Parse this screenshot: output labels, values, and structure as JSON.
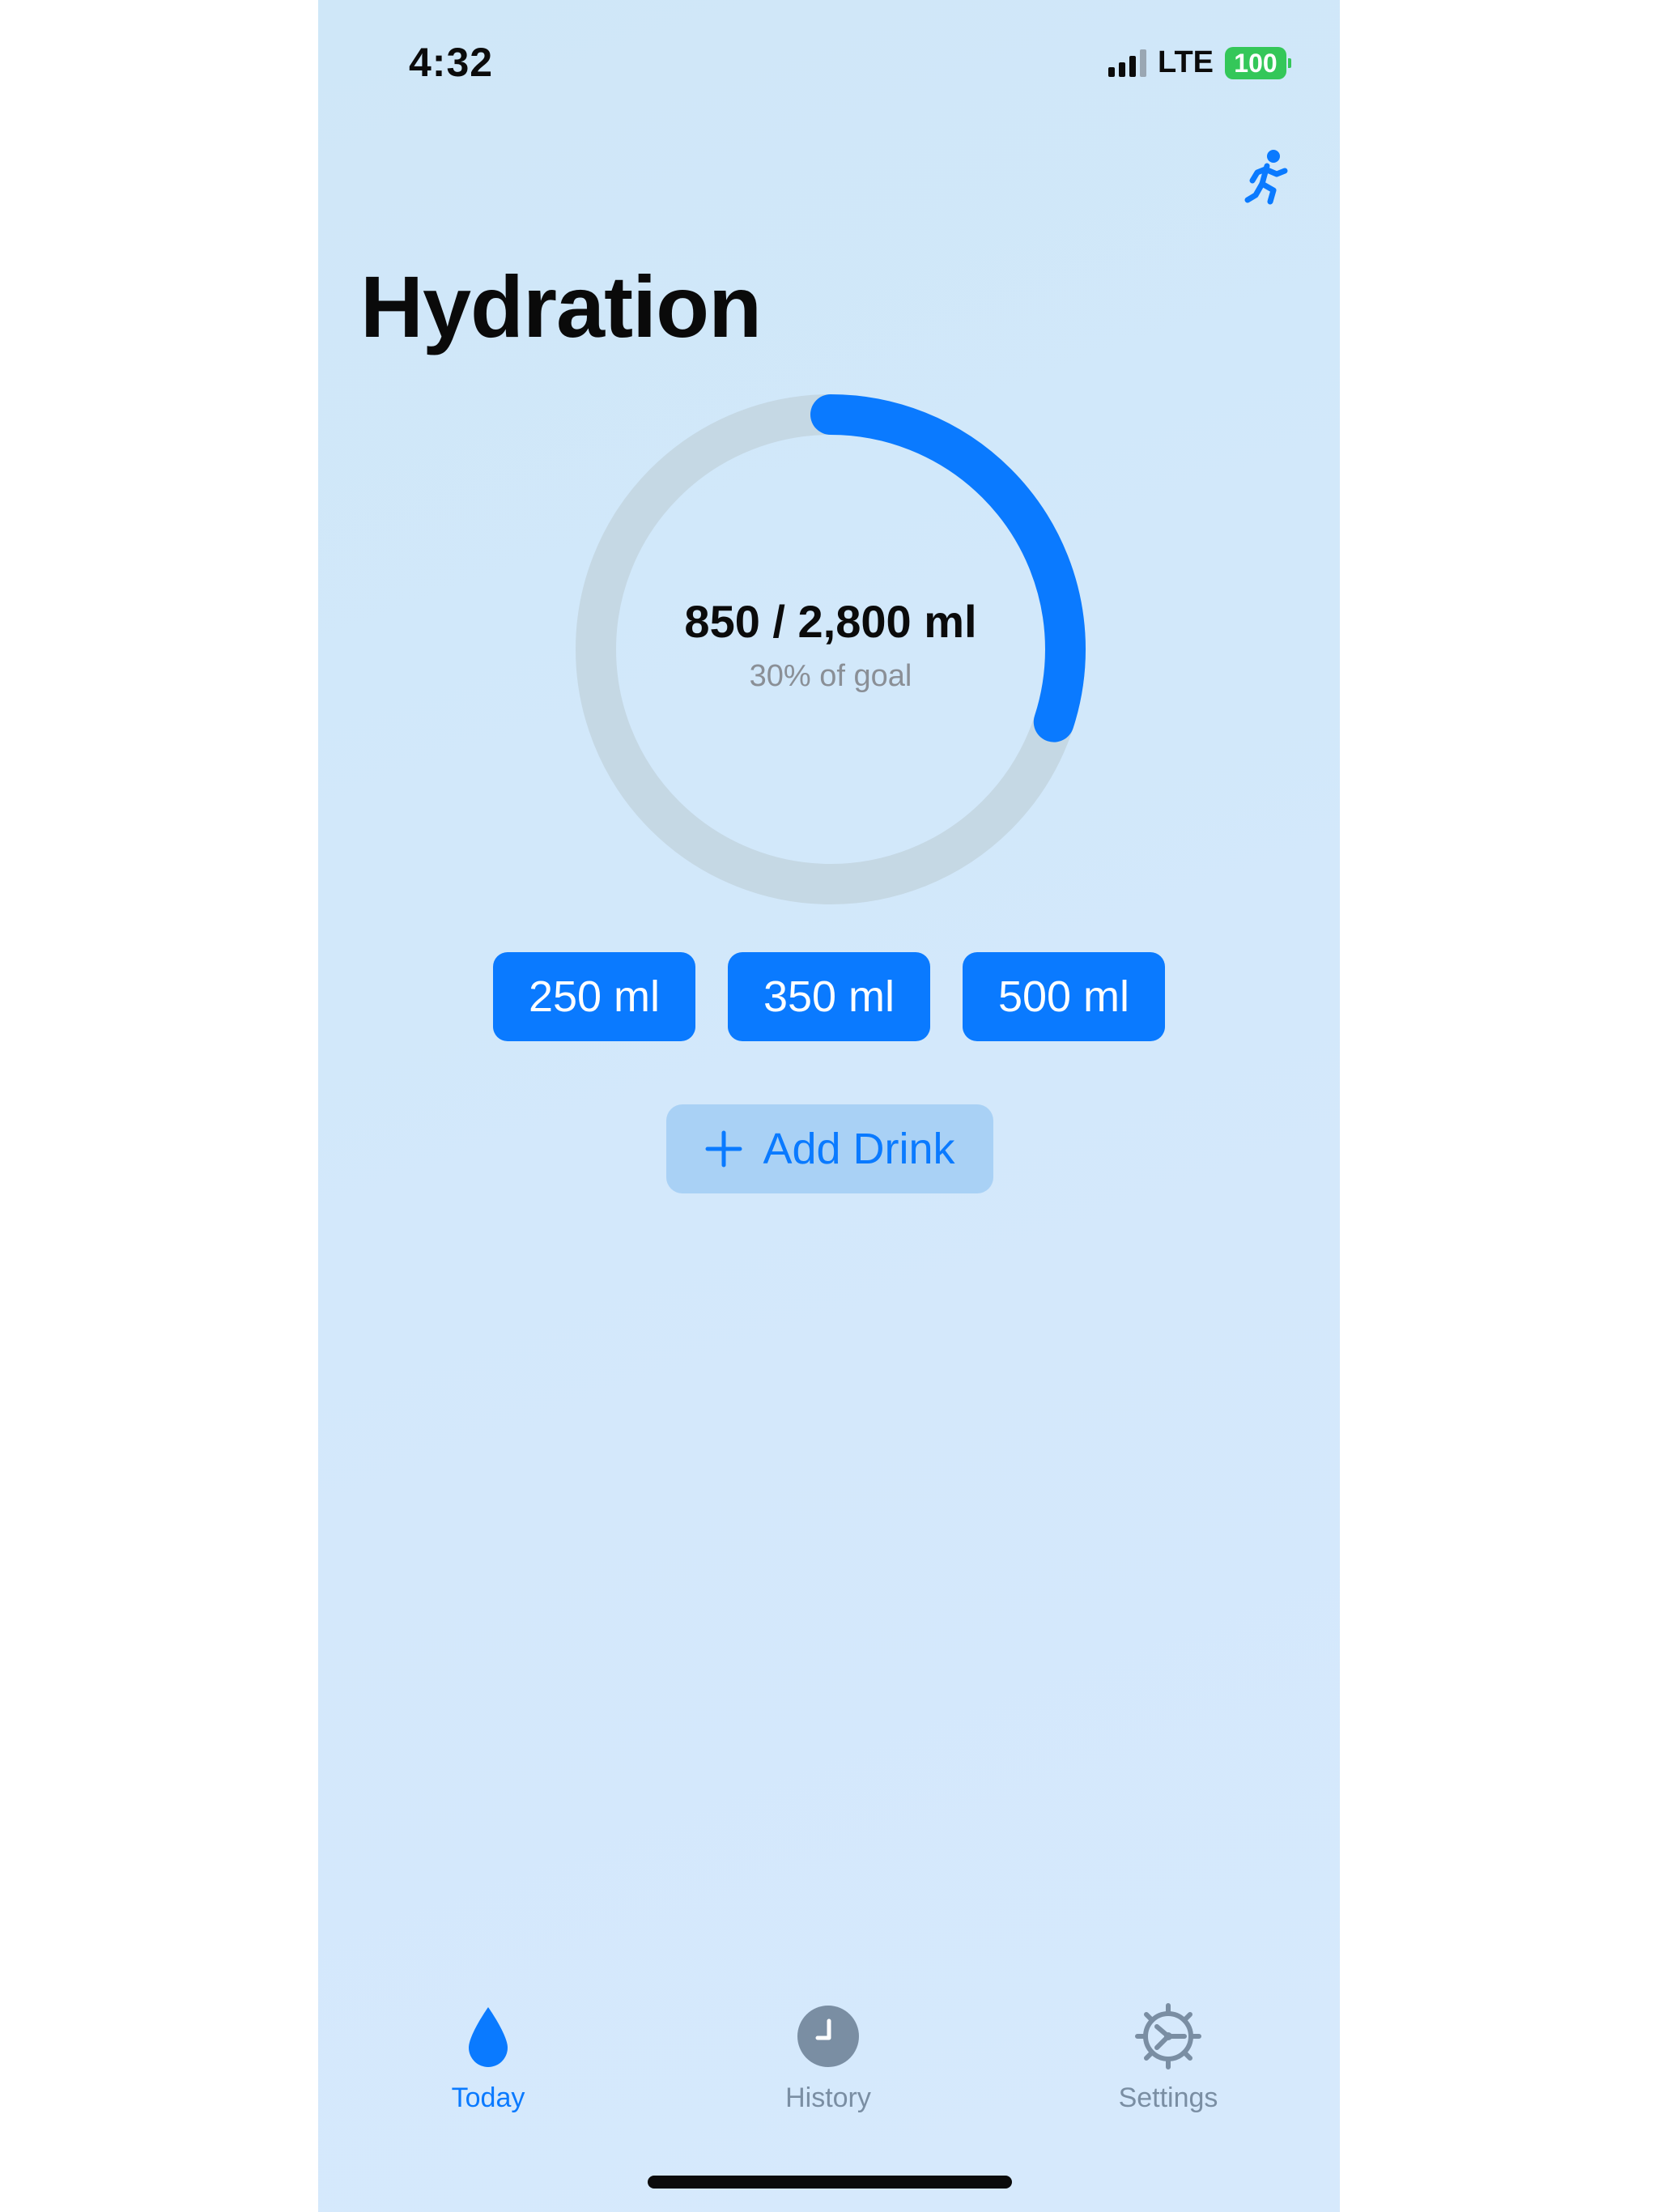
{
  "status_bar": {
    "time": "4:32",
    "network": "LTE",
    "battery": "100",
    "battery_color": "#34c759"
  },
  "header": {
    "title": "Hydration",
    "activity_icon": "running-figure-icon"
  },
  "progress": {
    "amount_text": "850 / 2,800 ml",
    "percent_text": "30% of goal",
    "fraction": 0.3,
    "track_color": "#c5d8e4",
    "fill_color": "#0a7aff"
  },
  "quick_add": [
    {
      "label": "250 ml"
    },
    {
      "label": "350 ml"
    },
    {
      "label": "500 ml"
    }
  ],
  "add_drink": {
    "label": "Add Drink",
    "icon": "plus-icon"
  },
  "tabs": [
    {
      "label": "Today",
      "icon": "water-drop-icon",
      "selected": true,
      "color": "#0a7aff"
    },
    {
      "label": "History",
      "icon": "clock-icon",
      "selected": false,
      "color": "#7a8ea3"
    },
    {
      "label": "Settings",
      "icon": "gear-icon",
      "selected": false,
      "color": "#7a8ea3"
    }
  ],
  "accent_color": "#0a7aff"
}
